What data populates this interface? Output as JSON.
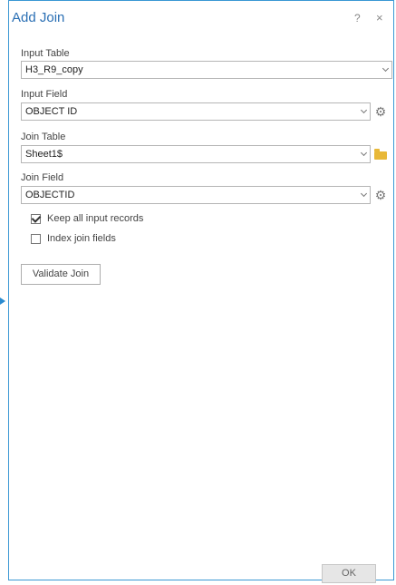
{
  "dialog": {
    "title": "Add Join",
    "help_glyph": "?",
    "close_glyph": "×"
  },
  "fields": {
    "input_table": {
      "label": "Input Table",
      "value": "H3_R9_copy"
    },
    "input_field": {
      "label": "Input Field",
      "value": "OBJECT ID"
    },
    "join_table": {
      "label": "Join Table",
      "value": "Sheet1$"
    },
    "join_field": {
      "label": "Join Field",
      "value": "OBJECTID"
    }
  },
  "options": {
    "keep_all": {
      "label": "Keep all input records",
      "checked": true
    },
    "index_join": {
      "label": "Index join fields",
      "checked": false
    }
  },
  "buttons": {
    "validate": "Validate Join",
    "ok": "OK"
  },
  "icons": {
    "field_settings": "gear-icon",
    "browse": "folder-icon",
    "gear_glyph": "⚙"
  },
  "colors": {
    "frame_border": "#3a98d4",
    "title_text": "#2a6fb4",
    "folder": "#e8b838"
  }
}
